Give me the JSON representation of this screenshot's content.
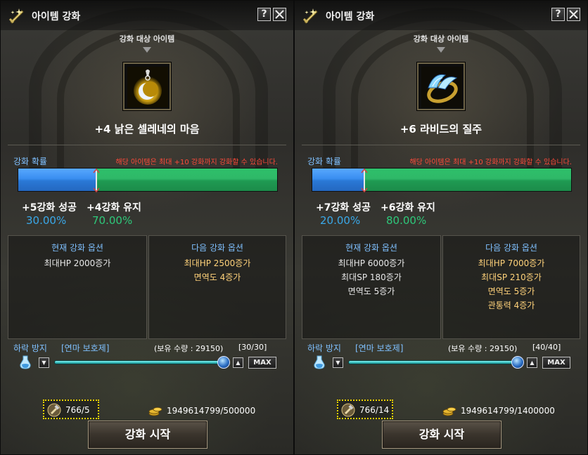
{
  "panels": [
    {
      "title": "아이템 강화",
      "help_label": "?",
      "target_label": "강화 대상 아이템",
      "item_name": "+4 낡은 셀레네의 마음",
      "rate_label": "강화 확률",
      "rate_warning": "해당 아이템은 최대 +10 강화까지 강화할 수 있습니다.",
      "success_fraction": 0.3,
      "success_label": "+5강화 성공",
      "success_pct": "30.00%",
      "keep_label": "+4강화 유지",
      "keep_pct": "70.00%",
      "current_title": "현재 강화 옵션",
      "current_options": [
        "최대HP 2000증가"
      ],
      "next_title": "다음 강화 옵션",
      "next_options": [
        "최대HP 2500증가",
        "면역도 4증가"
      ],
      "protect_label": "하락 방지",
      "protect_item": "[연마 보호제]",
      "held_qty": "(보유 수량 : 29150)",
      "use_count": "[30/30]",
      "slider_fraction": 1.0,
      "max_label": "MAX",
      "cost": "766/5",
      "zeny": "1949614799/500000",
      "start_label": "강화 시작"
    },
    {
      "title": "아이템 강화",
      "help_label": "?",
      "target_label": "강화 대상 아이템",
      "item_name": "+6 라비드의 질주",
      "rate_label": "강화 확률",
      "rate_warning": "해당 아이템은 최대 +10 강화까지 강화할 수 있습니다.",
      "success_fraction": 0.2,
      "success_label": "+7강화 성공",
      "success_pct": "20.00%",
      "keep_label": "+6강화 유지",
      "keep_pct": "80.00%",
      "current_title": "현재 강화 옵션",
      "current_options": [
        "최대HP 6000증가",
        "최대SP 180증가",
        "면역도 5증가"
      ],
      "next_title": "다음 강화 옵션",
      "next_options": [
        "최대HP 7000증가",
        "최대SP 210증가",
        "면역도 5증가",
        "관통력 4증가"
      ],
      "protect_label": "하락 방지",
      "protect_item": "[연마 보호제]",
      "held_qty": "(보유 수량 : 29150)",
      "use_count": "[40/40]",
      "slider_fraction": 1.0,
      "max_label": "MAX",
      "cost": "766/14",
      "zeny": "1949614799/1400000",
      "start_label": "강화 시작"
    }
  ],
  "colors": {
    "rate_blue": "#3a8ef0",
    "rate_green": "#2ec06a",
    "warning_red": "#ff4a3a",
    "label_blue": "#7fc0ff",
    "next_option_gold": "#ffd27a"
  },
  "icons": [
    "sword-enchant-icon",
    "help-icon",
    "close-icon",
    "moon-pendant-item-icon",
    "wing-ring-item-icon",
    "potion-icon",
    "arrow-down-icon",
    "arrow-up-icon",
    "hammer-coupon-icon",
    "zeny-coins-icon"
  ]
}
